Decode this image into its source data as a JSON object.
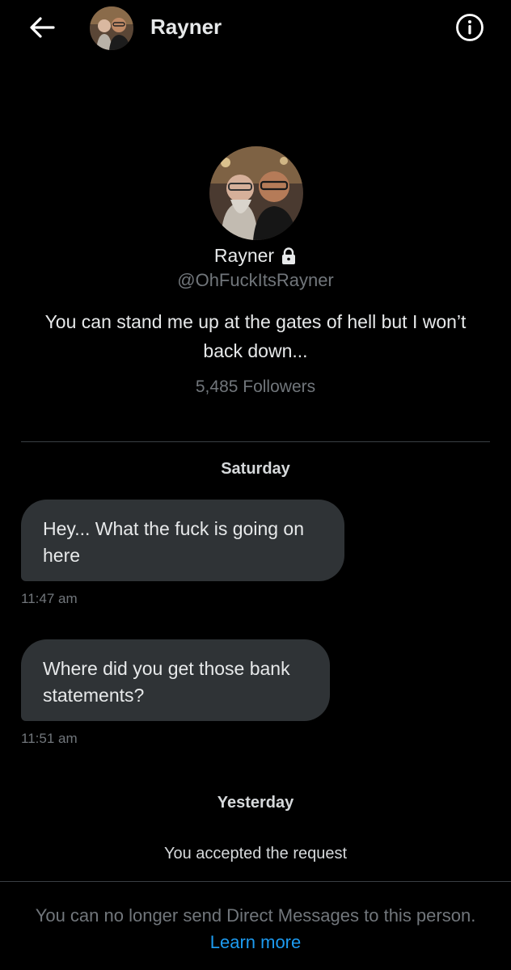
{
  "header": {
    "title": "Rayner"
  },
  "profile": {
    "name": "Rayner",
    "handle": "@OhFuckItsRayner",
    "bio": "You can stand me up at the gates of hell but I won’t back down...",
    "followers": "5,485 Followers"
  },
  "conversation": {
    "date_separator_1": "Saturday",
    "messages": [
      {
        "text": "Hey... What the fuck is going on here",
        "time": "11:47 am"
      },
      {
        "text": "Where did you get those bank statements?",
        "time": "11:51 am"
      }
    ],
    "date_separator_2": "Yesterday",
    "system_message": "You accepted the request"
  },
  "footer": {
    "notice": "You can no longer send Direct Messages to this person.",
    "link": "Learn more"
  },
  "colors": {
    "background": "#000000",
    "bubble": "#2f3336",
    "link": "#1d9bf0",
    "muted": "#71767b"
  }
}
